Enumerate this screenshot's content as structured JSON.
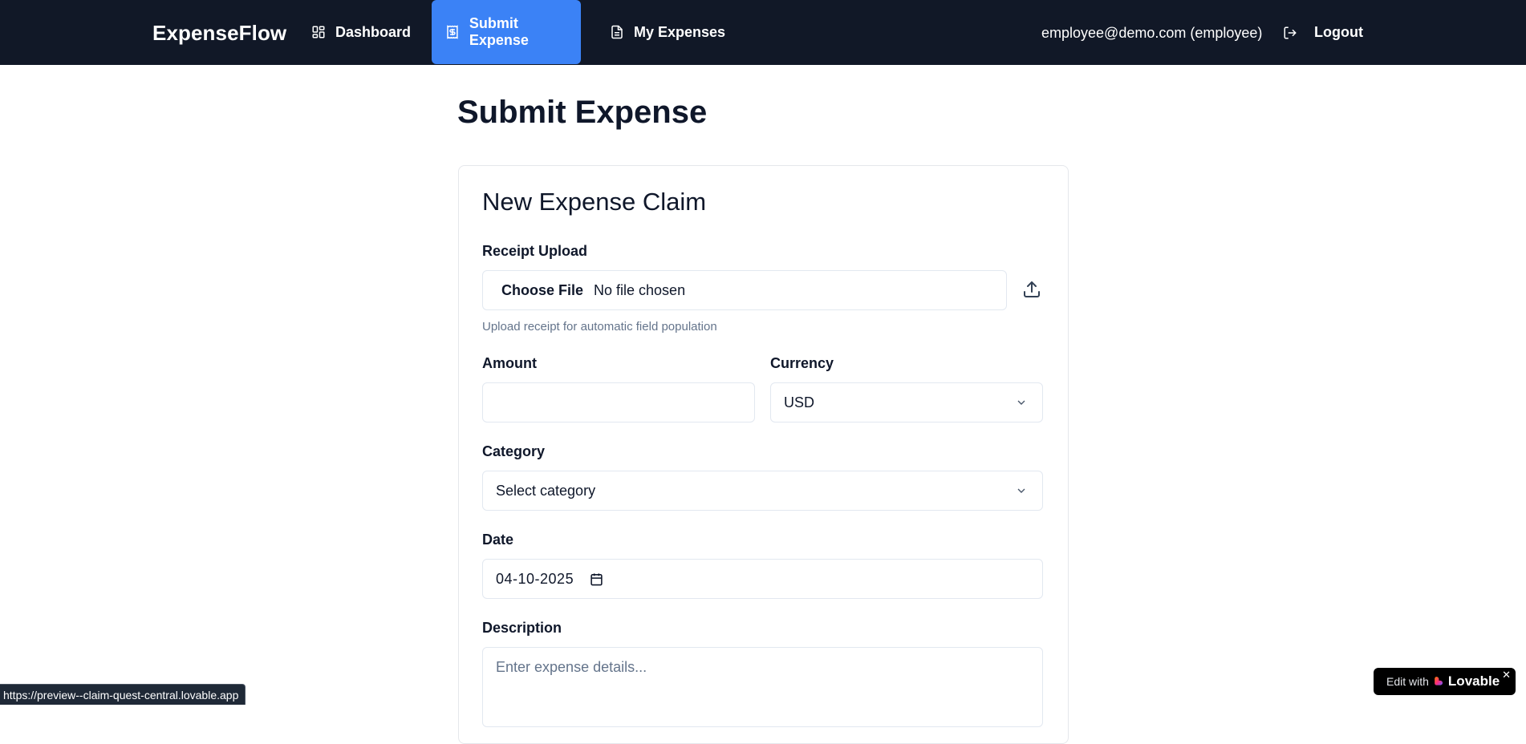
{
  "app": {
    "brand": "ExpenseFlow",
    "accent_color": "#3b82f6",
    "navbar_color": "#111827"
  },
  "nav": {
    "items": [
      {
        "label": "Dashboard",
        "icon": "layout-grid-icon",
        "active": false
      },
      {
        "label": "Submit Expense",
        "icon": "receipt-icon",
        "active": true
      },
      {
        "label": "My Expenses",
        "icon": "file-text-icon",
        "active": false
      }
    ],
    "user": "employee@demo.com (employee)",
    "logout_label": "Logout",
    "logout_icon": "logout-icon"
  },
  "page": {
    "title": "Submit Expense"
  },
  "form": {
    "card_title": "New Expense Claim",
    "receipt": {
      "label": "Receipt Upload",
      "button_label": "Choose File",
      "file_status": "No file chosen",
      "helper": "Upload receipt for automatic field population",
      "icon": "upload-icon"
    },
    "amount": {
      "label": "Amount",
      "value": ""
    },
    "currency": {
      "label": "Currency",
      "value": "USD",
      "icon": "chevron-down-icon"
    },
    "category": {
      "label": "Category",
      "placeholder": "Select category",
      "icon": "chevron-down-icon"
    },
    "date": {
      "label": "Date",
      "value": "04-10-2025",
      "icon": "calendar-icon"
    },
    "description": {
      "label": "Description",
      "placeholder": "Enter expense details..."
    }
  },
  "status_bar": {
    "url": "https://preview--claim-quest-central.lovable.app"
  },
  "badge": {
    "edit_text": "Edit with",
    "brand": "Lovable",
    "close": "✕"
  }
}
